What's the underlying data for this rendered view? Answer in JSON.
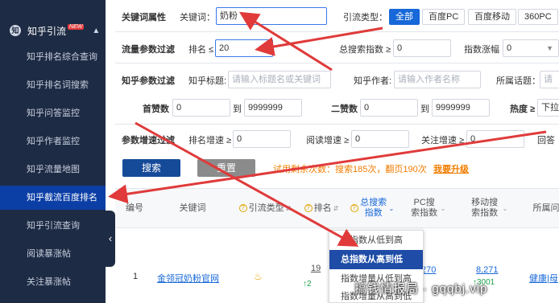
{
  "sidebar": {
    "section_label": "知乎引流",
    "new_badge": "NEW",
    "section_icon": "zhihu-icon",
    "items": [
      {
        "label": "知乎排名综合查询"
      },
      {
        "label": "知乎排名词搜索"
      },
      {
        "label": "知乎问答监控"
      },
      {
        "label": "知乎作者监控"
      },
      {
        "label": "知乎流量地图"
      },
      {
        "label": "知乎截流百度排名",
        "active": true
      },
      {
        "label": "知乎引流查询"
      },
      {
        "label": "阅读暴涨帖"
      },
      {
        "label": "关注暴涨帖"
      }
    ],
    "collapse_glyph": "‹"
  },
  "filters": {
    "keyword_attr_label": "关键词属性",
    "keyword_label": "关键词：",
    "keyword_value": "奶粉",
    "traffic_type_label": "引流类型：",
    "traffic_types": [
      "全部",
      "百度PC",
      "百度移动",
      "360PC"
    ],
    "traffic_param_label": "流量参数过滤",
    "rank_label": "排名 ≤",
    "rank_value": "20",
    "total_search_label": "总搜索指数 ≥",
    "total_search_value": "0",
    "index_rise_label": "指数涨幅",
    "index_rise_value": "0",
    "zhihu_param_label": "知乎参数过滤",
    "zhihu_title_label": "知乎标题:",
    "zhihu_title_placeholder": "请输入标题名或关键词",
    "zhihu_author_label": "知乎作者:",
    "zhihu_author_placeholder": "请输入作者名称",
    "topic_label": "所属话题：",
    "topic_placeholder": "请",
    "upvote_label": "首赞数",
    "upvote_min": "0",
    "upvote_to": "到",
    "upvote_max": "9999999",
    "second_upvote_label": "二赞数",
    "second_upvote_min": "0",
    "second_upvote_to": "到",
    "second_upvote_max": "9999999",
    "heat_label": "热度 ≥",
    "heat_value": "下拉",
    "growth_label": "参数增速过滤",
    "rank_growth_label": "排名增速 ≥",
    "rank_growth_value": "0",
    "read_growth_label": "阅读增速 ≥",
    "read_growth_value": "0",
    "follow_growth_label": "关注增速 ≥",
    "follow_growth_value": "0",
    "answer_growth_label": "回答"
  },
  "actions": {
    "search_label": "搜索",
    "reset_label": "重置",
    "trial_text": "试用剩余次数：搜索185次，翻页190次",
    "upgrade_label": "我要升级"
  },
  "table": {
    "headers": {
      "index": "编号",
      "keyword": "关键词",
      "traffic_type": "引流类型",
      "rank": "排名",
      "total_search": "总搜索指数",
      "pc_search": "PC搜索指数",
      "mobile_search": "移动搜索指数",
      "topic": "所属问"
    },
    "rows": [
      {
        "index": "1",
        "keyword": "金领冠奶粉官网",
        "rank": "19",
        "rank_change": "↑2",
        "pc_search": "270",
        "mobile_search": "8,271",
        "mobile_change": "↑3001",
        "topic": "健康|母"
      }
    ]
  },
  "sort_menu": {
    "items": [
      {
        "label": "总指数从低到高"
      },
      {
        "label": "总指数从高到低",
        "active": true
      },
      {
        "label": "指数增量从低到高"
      },
      {
        "label": "指数增量从高到低"
      }
    ]
  },
  "watermark": "搞钱情报局 · gqqbj.vip",
  "colors": {
    "sidebar_bg": "#1e2b44",
    "sidebar_active": "#0c3fa6",
    "accent_blue": "#1768d8",
    "annotation_arrow": "#e03a3a",
    "warning_orange": "#f07c00"
  }
}
